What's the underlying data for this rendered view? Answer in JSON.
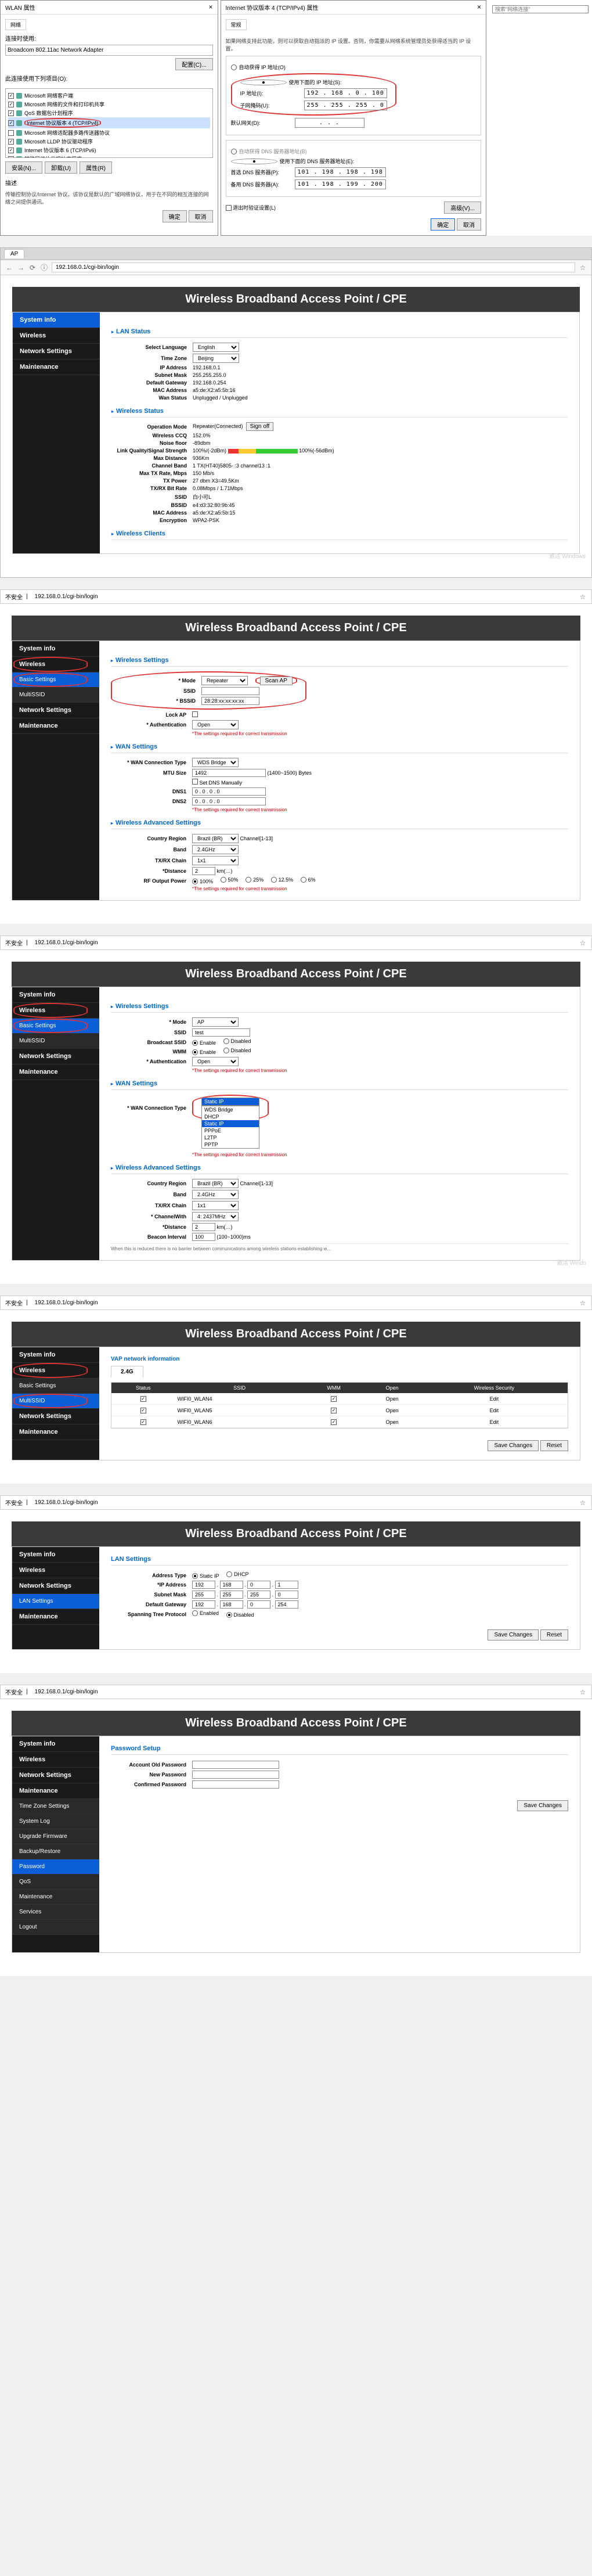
{
  "win_adapter": {
    "title": "WLAN 属性",
    "tab": "网络",
    "connect_label": "连接时使用:",
    "adapter": "Broadcom 802.11ac Network Adapter",
    "config_btn": "配置(C)...",
    "components_label": "此连接使用下列项目(O):",
    "components": [
      {
        "label": "Microsoft 网络客户端",
        "checked": true
      },
      {
        "label": "Microsoft 网络的文件和打印机共享",
        "checked": true
      },
      {
        "label": "QoS 数据包计划程序",
        "checked": true
      },
      {
        "label": "Internet 协议版本 4 (TCP/IPv4)",
        "checked": true,
        "highlight": true
      },
      {
        "label": "Microsoft 网络适配器多路传送器协议",
        "checked": false
      },
      {
        "label": "Microsoft LLDP 协议驱动程序",
        "checked": true
      },
      {
        "label": "Internet 协议版本 6 (TCP/IPv6)",
        "checked": true
      },
      {
        "label": "链路层拓扑发现响应程序",
        "checked": true
      }
    ],
    "install_btn": "安装(N)...",
    "uninstall_btn": "卸载(U)",
    "props_btn": "属性(R)",
    "desc_label": "描述",
    "desc_text": "传输控制协议/Internet 协议。该协议是默认的广域网络协议，用于在不同的相互连接的网络之间提供通讯。",
    "ok": "确定",
    "cancel": "取消"
  },
  "ipv4": {
    "title": "Internet 协议版本 4 (TCP/IPv4) 属性",
    "tab": "常规",
    "intro": "如果网络支持此功能，则可以获取自动指派的 IP 设置。否则，你需要从网络系统管理员处获得适当的 IP 设置。",
    "auto_ip": "自动获得 IP 地址(O)",
    "manual_ip": "使用下面的 IP 地址(S):",
    "ip_label": "IP 地址(I):",
    "ip_value": "192 . 168 .  0  . 100",
    "mask_label": "子网掩码(U):",
    "mask_value": "255 . 255 . 255 .  0 ",
    "gw_label": "默认网关(D):",
    "gw_value": " .  .  . ",
    "auto_dns": "自动获得 DNS 服务器地址(B)",
    "manual_dns": "使用下面的 DNS 服务器地址(E):",
    "dns1_label": "首选 DNS 服务器(P):",
    "dns1_value": "101 . 198 . 198 . 198",
    "dns2_label": "备用 DNS 服务器(A):",
    "dns2_value": "101 . 198 . 199 . 200",
    "validate": "退出时验证设置(L)",
    "adv_btn": "高级(V)...",
    "ok": "确定",
    "cancel": "取消",
    "search_placeholder": "搜索\"网络连接\""
  },
  "router": {
    "title": "Wireless Broadband Access Point / CPE",
    "url": "192.168.0.1/cgi-bin/login",
    "alt_addr_prefix": "不安全",
    "sidebar": {
      "system_info": "System info",
      "wireless": "Wireless",
      "basic_settings": "Basic Settings",
      "multi_ssid": "MultiSSID",
      "network_settings": "Network Settings",
      "lan_settings": "LAN Settings",
      "maintenance": "Maintenance",
      "time_zone": "Time Zone Settings",
      "system_log": "System Log",
      "upgrade": "Upgrade Firmware",
      "backup_restore": "Backup/Restore",
      "password": "Password",
      "qos": "QoS",
      "maint_sub": "Maintenance",
      "services": "Services",
      "logout": "Logout"
    },
    "lan_status": {
      "title": "LAN Status",
      "select_lang_lbl": "Select Language",
      "select_lang_val": "English",
      "time_zone_lbl": "Time Zone",
      "time_zone_val": "Beijing",
      "ip_lbl": "IP Address",
      "ip_val": "192.168.0.1",
      "subnet_lbl": "Subnet Mask",
      "subnet_val": "255.255.255.0",
      "gw_lbl": "Default Gateway",
      "gw_val": "192.168.0.254",
      "mac_lbl": "MAC Address",
      "mac_val": "a5:de:X2:a5:5b:16",
      "wan_lbl": "Wan Status",
      "wan_val": "Unplugged / Unplugged"
    },
    "wl_status": {
      "title": "Wireless Status",
      "op_mode_lbl": "Operation Mode",
      "op_mode_val": "Repeater(Connected)",
      "signoff": "Sign off",
      "vlan_ccq_lbl": "Wireless CCQ",
      "vlan_ccq_val": "152.0%",
      "noise_lbl": "Noise floor",
      "noise_val": "-89dbm",
      "link_lbl": "Link Quality/Signal Strength",
      "link_val": "100%/(-2dBm)",
      "link_extra": "100%(-56dBm)",
      "max_dist_lbl": "Max Distance",
      "max_dist_val": "936Km",
      "channel_band_lbl": "Channel Band",
      "channel_band_val": "1 TX(HT40)5805- :3  channel13 :1",
      "max_tx_lbl": "Max TX Rate, Mbps",
      "max_tx_val": "150 Mb/s",
      "tx_power_lbl": "TX Power",
      "tx_power_val": "27 dbm X3=49.5Km",
      "txrx_lbl": "TX/RX Bit Rate",
      "txrx_val": "0.08Mbps / 1.71Mbps",
      "ssid_lbl": "SSID",
      "ssid_val": "白小可L",
      "bssid_lbl": "BSSID",
      "bssid_val": "e4:d3:32:80:9b:45",
      "mac_lbl": "MAC Address",
      "mac_val": "a5:de:X2:a5:5b:15",
      "enc_lbl": "Encryption",
      "enc_val": "WPA2-PSK"
    },
    "wl_clients": "Wireless Clients",
    "wl_settings": {
      "title": "Wireless Settings",
      "mode_lbl": "* Mode",
      "mode_val_repeater": "Repeater",
      "mode_val_ap": "AP",
      "ssid_lbl": "SSID",
      "ssid_ph": "",
      "ssid_ap_ph": "test",
      "scan_btn": "Scan AP",
      "bssid_lbl": "* BSSID",
      "bssid_ph": "28:28:xx:xx:xx:xx",
      "lock_ap_lbl": "Lock AP",
      "bcast_ssid_lbl": "Broadcast SSID",
      "wmm_lbl": "WMM",
      "auth_lbl": "* Authentication",
      "auth_val": "Open",
      "enable": "Enable",
      "disable": "Disabled",
      "warn": "*The settings required for correct transmission"
    },
    "wan_settings": {
      "title": "WAN Settings",
      "conn_type_lbl": "* WAN Connection Type",
      "conn_type_val": "WDS Bridge",
      "conn_type_val2_sel": "Static IP",
      "conn_options": [
        "WDS Bridge",
        "DHCP",
        "Static IP",
        "PPPoE",
        "L2TP",
        "PPTP"
      ],
      "mtu_lbl": "MTU Size",
      "mtu_val": "1492",
      "mtu_hint": "(1400~1500) Bytes",
      "set_dns_lbl": "Set DNS Manually",
      "dns1_lbl": "DNS1",
      "dns2_lbl": "DNS2",
      "zero_ip": "0 . 0 . 0 . 0"
    },
    "adv": {
      "title": "Wireless Advanced Settings",
      "country_lbl": "Country Region",
      "country_val": "Brazil (BR)",
      "channel_hint": "Channel[1-13]",
      "band_lbl": "Band",
      "band_val": "2.4GHz",
      "txrx_chain_lbl": "TX/RX Chain",
      "txrx_chain_val": "1x1",
      "ch_width_lbl": "* ChannelWith",
      "ch_width_val": "4: 2437MHz",
      "dist_lbl": "*Distance",
      "dist_val": "2",
      "dist_unit": "km(…)",
      "rf_lbl": "RF Output Power",
      "rf_100": "100%",
      "rf_50": "50%",
      "rf_25": "25%",
      "rf_12": "12.5%",
      "rf_6": "6%",
      "beacon_lbl": "Beacon Interval",
      "beacon_val": "100",
      "beacon_hint": "(100~1000)ms",
      "beacon_note": "When this is reduced there is no barrier between communications among wireless stations establishing w…"
    },
    "vap": {
      "title": "VAP network information",
      "tab": "2.4G",
      "col_status": "Status",
      "col_ssid": "SSID",
      "col_wmm": "WMM",
      "col_auth": "Open",
      "col_sec": "Wireless Security",
      "rows": [
        {
          "ssid": "WIFI0_WLAN4",
          "wmm": true,
          "auth": "Open",
          "sec": "Edit"
        },
        {
          "ssid": "WIFI0_WLAN5",
          "wmm": true,
          "auth": "Open",
          "sec": "Edit"
        },
        {
          "ssid": "WIFI0_WLAN6",
          "wmm": true,
          "auth": "Open",
          "sec": "Edit"
        }
      ]
    },
    "lan_set": {
      "title": "LAN Settings",
      "addr_type_lbl": "Address Type",
      "static": "Static IP",
      "dhcp": "DHCP",
      "ip_lbl": "*IP Address",
      "ip_o": [
        "192",
        "168",
        "0",
        "1"
      ],
      "mask_lbl": "Subnet Mask",
      "mask_o": [
        "255",
        "255",
        "255",
        "0"
      ],
      "gw_lbl": "Default Gateway",
      "gw_o": [
        "192",
        "168",
        "0",
        "254"
      ],
      "stp_lbl": "Spanning Tree Protocol",
      "enabled": "Enabled",
      "disabled": "Disabled"
    },
    "pwd": {
      "title": "Password Setup",
      "old_lbl": "Account Old Password",
      "new_lbl": "New Password",
      "conf_lbl": "Confirmed Password"
    },
    "buttons": {
      "save": "Save Changes",
      "reset": "Reset"
    },
    "browser_tab": "AP"
  }
}
